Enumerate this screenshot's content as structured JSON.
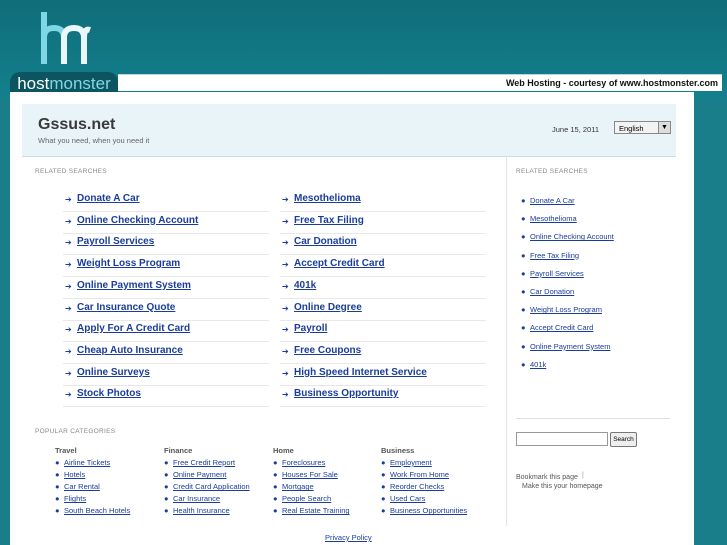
{
  "brand": {
    "logo_main": "host",
    "logo_accent": "monster",
    "banner": "Web Hosting - courtesy of www.hostmonster.com"
  },
  "site": {
    "title": "Gssus.net",
    "tagline": "What you need, when you need it",
    "date": "June 15, 2011",
    "language": "English"
  },
  "related_label": "RELATED SEARCHES",
  "main_links_left": [
    "Donate A Car",
    "Online Checking Account",
    "Payroll Services",
    "Weight Loss Program",
    "Online Payment System",
    "Car Insurance Quote",
    "Apply For A Credit Card",
    "Cheap Auto Insurance",
    "Online Surveys",
    "Stock Photos"
  ],
  "main_links_right": [
    "Mesothelioma",
    "Free Tax Filing",
    "Car Donation",
    "Accept Credit Card",
    "401k",
    "Online Degree",
    "Payroll",
    "Free Coupons",
    "High Speed Internet Service",
    "Business Opportunity"
  ],
  "side_links": [
    "Donate A Car",
    "Mesothelioma",
    "Online Checking Account",
    "Free Tax Filing",
    "Payroll Services",
    "Car Donation",
    "Weight Loss Program",
    "Accept Credit Card",
    "Online Payment System",
    "401k"
  ],
  "search": {
    "button": "Search"
  },
  "bookmark": {
    "bookmark": "Bookmark this page",
    "homepage": "Make this your homepage"
  },
  "popular_label": "POPULAR CATEGORIES",
  "categories": [
    {
      "title": "Travel",
      "links": [
        "Airline Tickets",
        "Hotels",
        "Car Rental",
        "Flights",
        "South Beach Hotels"
      ]
    },
    {
      "title": "Finance",
      "links": [
        "Free Credit Report",
        "Online Payment",
        "Credit Card Application",
        "Car Insurance",
        "Health Insurance"
      ]
    },
    {
      "title": "Home",
      "links": [
        "Foreclosures",
        "Houses For Sale",
        "Mortgage",
        "People Search",
        "Real Estate Training"
      ]
    },
    {
      "title": "Business",
      "links": [
        "Employment",
        "Work From Home",
        "Reorder Checks",
        "Used Cars",
        "Business Opportunities"
      ]
    }
  ],
  "footer": {
    "privacy": "Privacy Policy"
  }
}
